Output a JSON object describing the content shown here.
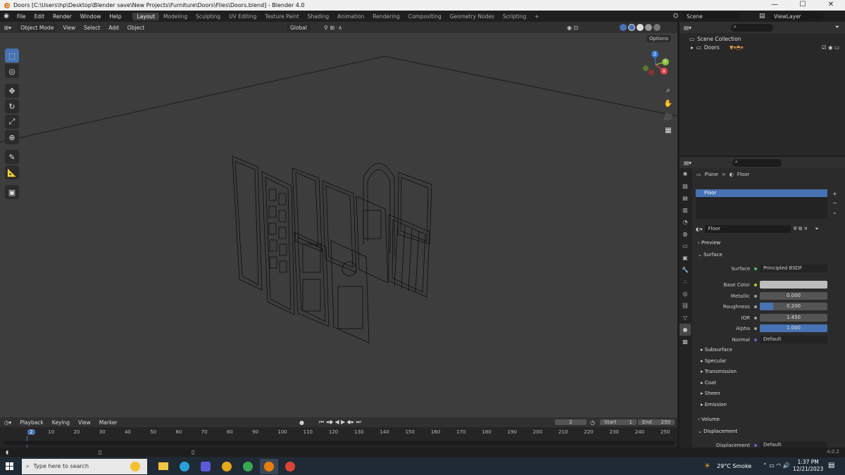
{
  "window": {
    "title": "Doors [C:\\Users\\hp\\Desktop\\Blender save\\New Projects\\Furniture\\Doors\\Files\\Doors.blend] - Blender 4.0",
    "minimize": "—",
    "maximize": "☐",
    "close": "✕"
  },
  "menu": [
    "File",
    "Edit",
    "Render",
    "Window",
    "Help"
  ],
  "workspaces": [
    "Layout",
    "Modeling",
    "Sculpting",
    "UV Editing",
    "Texture Paint",
    "Shading",
    "Animation",
    "Rendering",
    "Compositing",
    "Geometry Nodes",
    "Scripting"
  ],
  "workspace_add": "+",
  "scene": "Scene",
  "view_layer": "ViewLayer",
  "viewport_header": {
    "mode": "Object Mode",
    "menus": [
      "View",
      "Select",
      "Add",
      "Object"
    ],
    "transform": "Global",
    "options": "Options"
  },
  "outliner": {
    "root": "Scene Collection",
    "collection": "Doors"
  },
  "properties": {
    "breadcrumb_object": "Plane",
    "breadcrumb_sep": ">",
    "breadcrumb_material": "Floor",
    "slot": "Floor",
    "material_name": "Floor",
    "sections": {
      "preview": "Preview",
      "surface": "Surface",
      "volume": "Volume",
      "displacement": "Displacement"
    },
    "surface_shader_label": "Surface",
    "surface_shader": "Principled BSDF",
    "base_color_label": "Base Color",
    "base_color": "#bdbdbd",
    "metallic_label": "Metallic",
    "metallic": "0.000",
    "roughness_label": "Roughness",
    "roughness": "0.200",
    "ior_label": "IOR",
    "ior": "1.450",
    "alpha_label": "Alpha",
    "alpha": "1.000",
    "normal_label": "Normal",
    "normal": "Default",
    "subsections": [
      "Subsurface",
      "Specular",
      "Transmission",
      "Coat",
      "Sheen",
      "Emission"
    ],
    "displacement_label": "Displacement",
    "displacement_value": "Default"
  },
  "timeline": {
    "menus": [
      "Playback",
      "Keying",
      "View",
      "Marker"
    ],
    "current_frame": "2",
    "start_label": "Start",
    "start": "1",
    "end_label": "End",
    "end": "250",
    "ticks": [
      "2",
      "10",
      "20",
      "30",
      "40",
      "50",
      "60",
      "70",
      "80",
      "90",
      "100",
      "110",
      "120",
      "130",
      "140",
      "150",
      "160",
      "170",
      "180",
      "190",
      "200",
      "210",
      "220",
      "230",
      "240",
      "250"
    ]
  },
  "status": {
    "version": "4.0.2"
  },
  "taskbar": {
    "search_placeholder": "Type here to search",
    "weather": "29°C  Smoke",
    "time": "1:37 PM",
    "date": "12/21/2023"
  },
  "accent": "#4772b3"
}
